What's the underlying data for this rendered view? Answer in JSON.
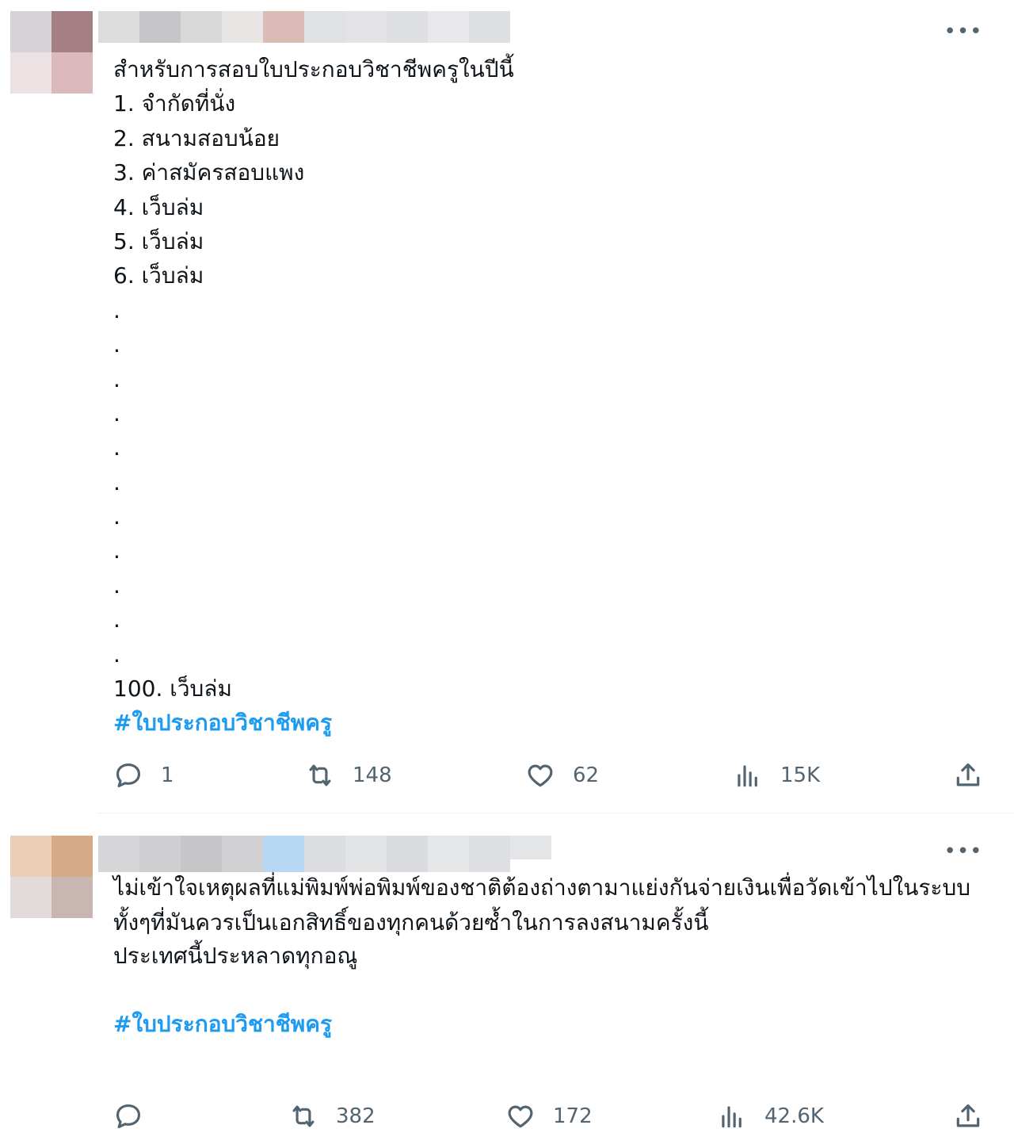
{
  "tweet1": {
    "more_label": "•••",
    "lines": [
      "สำหรับการสอบใบประกอบวิชาชีพครูในปีนี้",
      "1. จำกัดที่นั่ง",
      "2. สนามสอบน้อย",
      "3. ค่าสมัครสอบแพง",
      "4. เว็บล่ม",
      "5. เว็บล่ม",
      "6. เว็บล่ม",
      ".",
      ".",
      ".",
      ".",
      ".",
      ".",
      ".",
      ".",
      ".",
      ".",
      ".",
      "100. เว็บล่ม"
    ],
    "hashtag": "#ใบประกอบวิชาชีพครู",
    "actions": {
      "reply": "1",
      "retweet": "148",
      "like": "62",
      "views": "15K"
    }
  },
  "tweet2": {
    "more_label": "•••",
    "paragraph1": "ไม่เข้าใจเหตุผลที่แม่พิมพ์พ่อพิมพ์ของชาติต้องถ่างตามาแย่งกันจ่ายเงินเพื่อวัดเข้าไปในระบบ ทั้งๆที่มันควรเป็นเอกสิทธิ์ของทุกคนด้วยซ้ำในการลงสนามครั้งนี้",
    "paragraph2": "ประเทศนี้ประหลาดทุกอณู",
    "hashtag": "#ใบประกอบวิชาชีพครู",
    "actions": {
      "reply": "",
      "retweet": "382",
      "like": "172",
      "views": "42.6K"
    }
  },
  "colors": {
    "text": "#0f1419",
    "muted": "#536471",
    "link": "#1d9bf0",
    "divider": "#eff3f4"
  },
  "icons": [
    "reply-icon",
    "retweet-icon",
    "like-icon",
    "views-icon",
    "share-icon",
    "more-icon"
  ]
}
